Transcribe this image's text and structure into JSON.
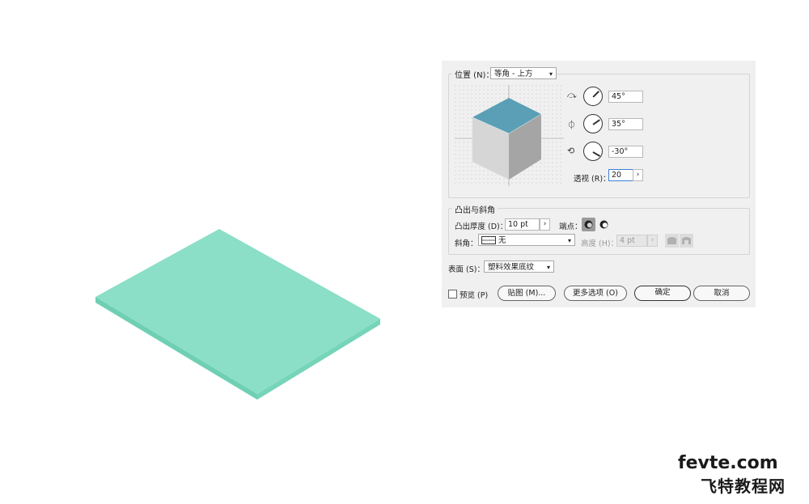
{
  "colors": {
    "slab_top": "#8adfc6",
    "slab_side": "#6fcfb3",
    "cube_top": "#5a9fb5",
    "cube_left": "#d2d2d2",
    "cube_right": "#a8a8a8",
    "dialog_bg": "#f0f0f0",
    "focus": "#3d7fd8"
  },
  "position": {
    "label": "位置 (N)：",
    "preset": "等角 - 上方",
    "rotations": [
      {
        "icon": "x-axis-rotation-icon",
        "value": "45°"
      },
      {
        "icon": "y-axis-rotation-icon",
        "value": "35°"
      },
      {
        "icon": "z-axis-rotation-icon",
        "value": "-30°"
      }
    ],
    "perspective_label": "透视 (R)：",
    "perspective_value": "20",
    "stepper_glyph": "›"
  },
  "extrude": {
    "group_title": "凸出与斜角",
    "depth_label": "凸出厚度 (D)：",
    "depth_value": "10 pt",
    "cap_label": "端点：",
    "bevel_label": "斜角：",
    "bevel_value": "无",
    "height_label": "高度 (H)：",
    "height_value": "4 pt"
  },
  "surface": {
    "label": "表面 (S)：",
    "value": "塑料效果底纹"
  },
  "footer": {
    "preview_label": "预览 (P)",
    "map_button": "贴图 (M)...",
    "more_options_button": "更多选项 (O)",
    "ok_button": "确定",
    "cancel_button": "取消"
  },
  "watermark": {
    "en": "fevte.com",
    "zh": "飞特教程网"
  }
}
